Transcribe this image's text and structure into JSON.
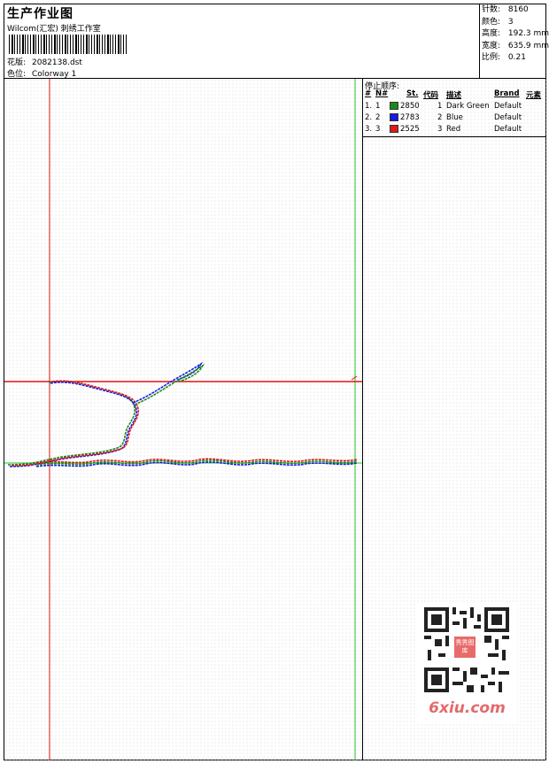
{
  "header": {
    "title": "生产作业图",
    "studio": "Wilcom(汇宏) 刺绣工作室",
    "design_label": "花版:",
    "design_value": "2082138.dst",
    "colorway_label": "色位:",
    "colorway_value": "Colorway 1"
  },
  "stats": {
    "stitches_label": "针数:",
    "stitches_value": "8160",
    "colors_label": "颜色:",
    "colors_value": "3",
    "height_label": "高度:",
    "height_value": "192.3 mm",
    "width_label": "宽度:",
    "width_value": "635.9 mm",
    "scale_label": "比例:",
    "scale_value": "0.21"
  },
  "stop_sequence": {
    "title": "停止顺序:",
    "headers": {
      "hash": "#",
      "no": "N#",
      "st": "St.",
      "code": "代码",
      "desc": "描述",
      "brand": "Brand",
      "elem": "元素"
    },
    "rows": [
      {
        "hash": "1.",
        "no": "1",
        "color": "#1a8a1a",
        "st": "2850",
        "code": "1",
        "desc": "Dark Green",
        "brand": "Default"
      },
      {
        "hash": "2.",
        "no": "2",
        "color": "#1a1ae0",
        "st": "2783",
        "code": "2",
        "desc": "Blue",
        "brand": "Default"
      },
      {
        "hash": "3.",
        "no": "3",
        "color": "#e01a1a",
        "st": "2525",
        "code": "3",
        "desc": "Red",
        "brand": "Default"
      }
    ]
  },
  "watermark": {
    "site": "6xiu.com",
    "badge": "秀秀图库"
  },
  "colors": {
    "guide_red": "#e01010",
    "guide_green": "#20c020",
    "thread_green": "#1a8a1a",
    "thread_blue": "#1a1ae0",
    "thread_red": "#e01a1a"
  }
}
